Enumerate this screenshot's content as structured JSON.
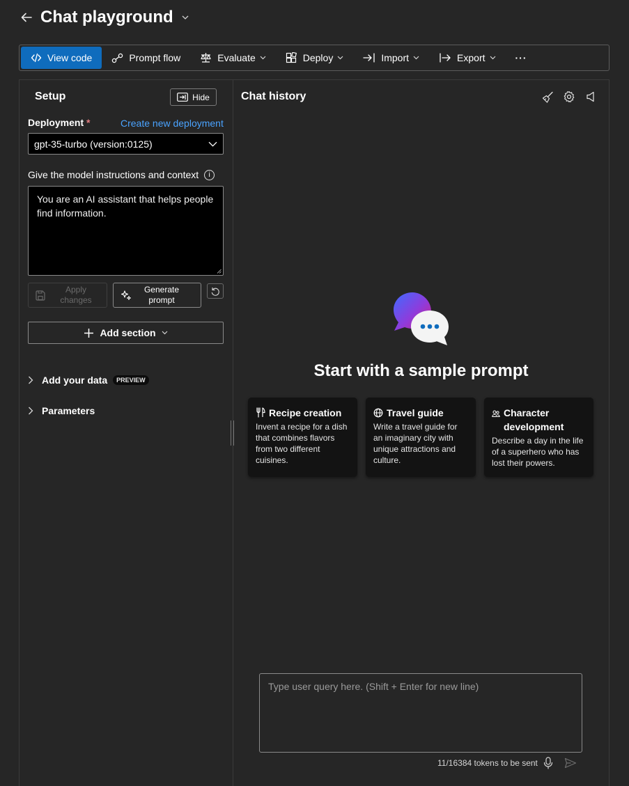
{
  "header": {
    "title": "Chat playground"
  },
  "toolbar": {
    "view_code": "View code",
    "prompt_flow": "Prompt flow",
    "evaluate": "Evaluate",
    "deploy": "Deploy",
    "import": "Import",
    "export": "Export",
    "more": "···"
  },
  "setup": {
    "title": "Setup",
    "hide_label": "Hide",
    "deployment_label": "Deployment",
    "required_mark": "*",
    "create_link": "Create new deployment",
    "deployment_value": "gpt-35-turbo (version:0125)",
    "instructions_label": "Give the model instructions and context",
    "instructions_value": "You are an AI assistant that helps people find information.",
    "apply_label": "Apply changes",
    "generate_label": "Generate prompt",
    "add_section_label": "Add section",
    "add_your_data": "Add your data",
    "preview_badge": "PREVIEW",
    "parameters": "Parameters"
  },
  "chat": {
    "title": "Chat history",
    "start_title": "Start with a sample prompt",
    "cards": [
      {
        "title": "Recipe creation",
        "desc": "Invent a recipe for a dish that combines flavors from two different cuisines.",
        "icon": "utensils-icon"
      },
      {
        "title": "Travel guide",
        "desc": "Write a travel guide for an imaginary city with unique attractions and culture.",
        "icon": "globe-icon"
      },
      {
        "title": "Character development",
        "desc": "Describe a day in the life of a superhero who has lost their powers.",
        "icon": "people-icon"
      }
    ],
    "input_placeholder": "Type user query here. (Shift + Enter for new line)",
    "tokens_text": "11/16384 tokens to be sent"
  },
  "colors": {
    "background": "#262626",
    "primary": "#0f6cbd",
    "link": "#4aa3ff",
    "card": "#131313"
  }
}
